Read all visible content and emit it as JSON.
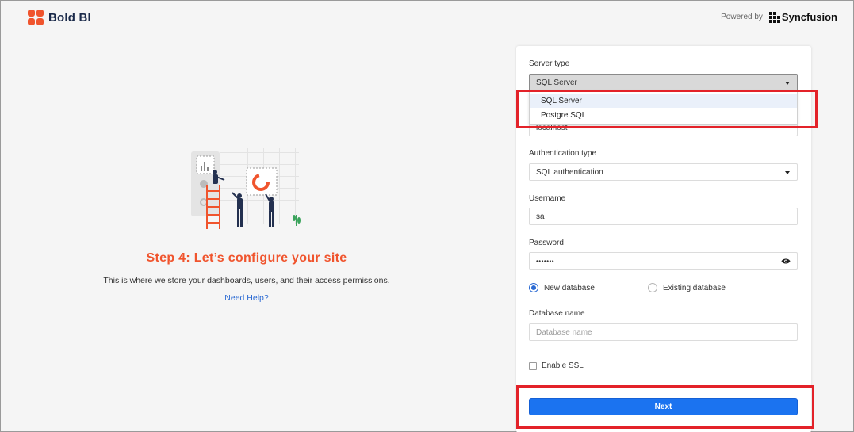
{
  "app": {
    "logo_text": "Bold BI",
    "powered_label": "Powered by",
    "vendor_name": "Syncfusion",
    "accent_color": "#f0542d",
    "primary_color": "#1b73f0"
  },
  "intro": {
    "title": "Step 4: Let’s configure your site",
    "description": "This is where we store your dashboards, users, and their access permissions.",
    "help_link": "Need Help?"
  },
  "form": {
    "server_type": {
      "label": "Server type",
      "value": "SQL Server",
      "options": [
        "SQL Server",
        "Postgre SQL"
      ],
      "hidden_field_value": "localhost"
    },
    "auth_type": {
      "label": "Authentication type",
      "value": "SQL authentication"
    },
    "username": {
      "label": "Username",
      "value": "sa"
    },
    "password": {
      "label": "Password",
      "value": "•••••••"
    },
    "database_mode": {
      "new_label": "New database",
      "existing_label": "Existing database",
      "selected": "New database"
    },
    "database_name": {
      "label": "Database name",
      "placeholder": "Database name"
    },
    "ssl": {
      "label": "Enable SSL",
      "checked": false
    },
    "next_label": "Next"
  },
  "icons": {
    "logo": "bold-bi-logo-icon",
    "password_toggle": "eye-icon",
    "dropdown": "caret-down-icon"
  }
}
